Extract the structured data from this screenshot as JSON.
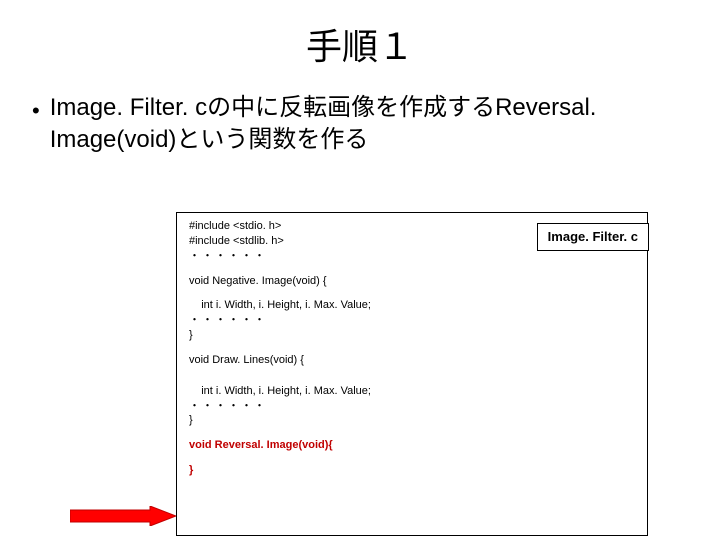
{
  "title": "手順１",
  "bullet": {
    "dot": "•",
    "text": "Image. Filter. cの中に反転画像を作成するReversal. Image(void)という関数を作る"
  },
  "code": {
    "include1": "#include <stdio. h>",
    "include2": "#include <stdlib. h>",
    "dots": "・・・・・・",
    "negativeDecl": "void Negative. Image(void) {",
    "intDecl": "    int i. Width, i. Height, i. Max. Value;",
    "closeBrace": "}",
    "drawDecl": "void Draw. Lines(void) {",
    "reversalDecl": "void Reversal. Image(void){",
    "reversalClose": "}"
  },
  "filename": "Image. Filter. c"
}
